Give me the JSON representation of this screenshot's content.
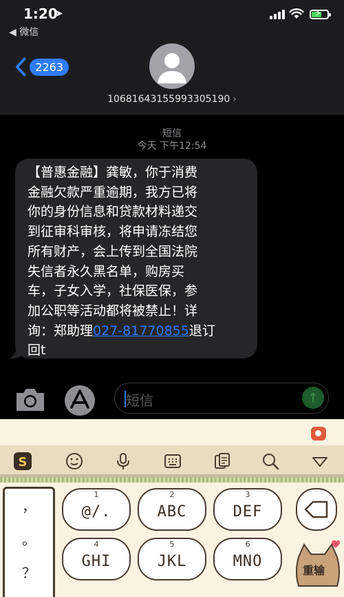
{
  "status_bar": {
    "time": "1:20",
    "back_app": "◀ 微信"
  },
  "header": {
    "back_badge": "2263",
    "contact": "10681643155993305190"
  },
  "conversation": {
    "service": "短信",
    "timestamp": "今天 下午12:54",
    "message": {
      "text_lines": [
        "【普惠金融】龚敏，你于消费",
        "金融欠款严重逾期，我方已将",
        "你的身份信息和贷款材料递交",
        "到征审科审核，将申请冻结您",
        "所有财产，会上传到全国法院",
        "失信者永久黑名单，购房买",
        "车，子女入学，社保医保，参",
        "加公职等活动都将被禁止！详"
      ],
      "line9_prefix": "询：郑助理",
      "phone": "027-81770855",
      "line9_suffix": "退订",
      "line10": "回t"
    }
  },
  "input_bar": {
    "placeholder": "短信",
    "send_label": "↑"
  },
  "keyboard": {
    "side_keys": [
      "，",
      "。",
      "？"
    ],
    "keys": [
      {
        "num": "1",
        "label": "@/."
      },
      {
        "num": "2",
        "label": "ABC"
      },
      {
        "num": "3",
        "label": "DEF"
      },
      {
        "num": "4",
        "label": "GHI"
      },
      {
        "num": "5",
        "label": "JKL"
      },
      {
        "num": "6",
        "label": "MNO"
      }
    ],
    "reenter_label": "重输"
  },
  "colors": {
    "accent": "#2f7cf6",
    "bubble": "#262628",
    "keyboard_bg": "#fbf3e2"
  }
}
